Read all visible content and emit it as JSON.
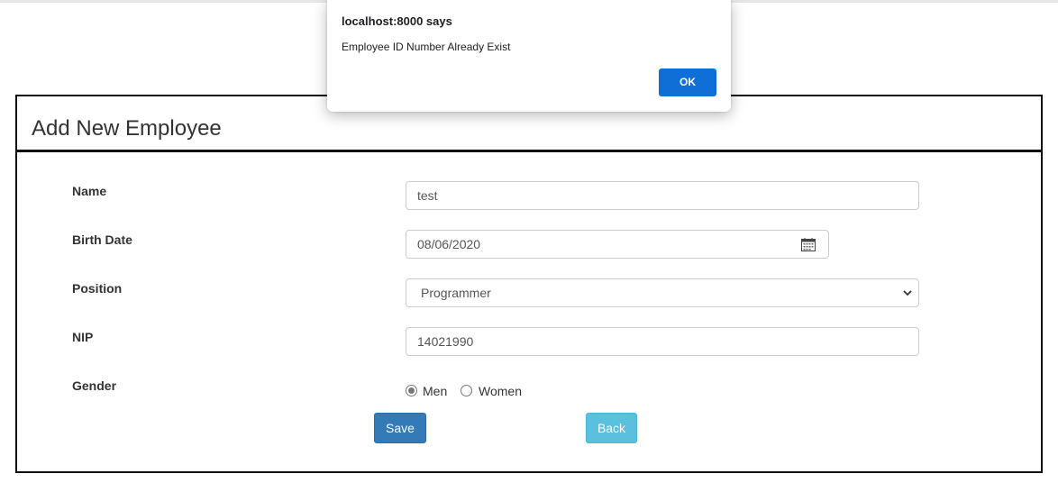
{
  "dialog": {
    "title": "localhost:8000 says",
    "message": "Employee ID Number Already Exist",
    "ok_label": "OK"
  },
  "form": {
    "title": "Add New Employee",
    "name": {
      "label": "Name",
      "value": "test"
    },
    "birth_date": {
      "label": "Birth Date",
      "value": "08/06/2020"
    },
    "position": {
      "label": "Position",
      "value": "Programmer"
    },
    "nip": {
      "label": "NIP",
      "value": "14021990"
    },
    "gender": {
      "label": "Gender",
      "options": [
        {
          "label": "Men",
          "checked": true
        },
        {
          "label": "Women",
          "checked": false
        }
      ]
    },
    "save_label": "Save",
    "back_label": "Back"
  },
  "colors": {
    "save_button": "#337ab7",
    "back_button": "#5bc0de",
    "dialog_ok": "#0f6fd6"
  }
}
